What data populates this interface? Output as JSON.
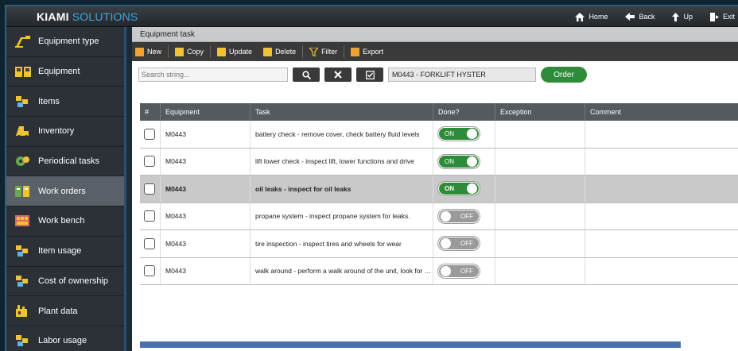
{
  "app": {
    "brand_main": "KIAMI",
    "brand_sub": "SOLUTIONS"
  },
  "topnav": [
    {
      "label": "Home",
      "icon": "home-icon"
    },
    {
      "label": "Back",
      "icon": "back-arrow-icon"
    },
    {
      "label": "Up",
      "icon": "up-arrow-icon"
    },
    {
      "label": "Exit",
      "icon": "exit-door-icon"
    }
  ],
  "sidebar": {
    "items": [
      {
        "label": "Equipment type",
        "icon": "equipment-type-icon"
      },
      {
        "label": "Equipment",
        "icon": "equipment-icon"
      },
      {
        "label": "Items",
        "icon": "items-icon"
      },
      {
        "label": "Inventory",
        "icon": "inventory-icon"
      },
      {
        "label": "Periodical tasks",
        "icon": "periodical-tasks-icon"
      },
      {
        "label": "Work orders",
        "icon": "work-orders-icon",
        "active": true
      },
      {
        "label": "Work bench",
        "icon": "work-bench-icon"
      },
      {
        "label": "Item usage",
        "icon": "item-usage-icon"
      },
      {
        "label": "Cost of ownership",
        "icon": "cost-of-ownership-icon"
      },
      {
        "label": "Plant data",
        "icon": "plant-data-icon"
      },
      {
        "label": "Labor usage",
        "icon": "labor-usage-icon"
      }
    ]
  },
  "main": {
    "title": "Equipment task",
    "toolbar": {
      "new": "New",
      "copy": "Copy",
      "update": "Update",
      "delete": "Delete",
      "filter": "Filter",
      "export": "Export"
    },
    "search": {
      "placeholder": "Search string...",
      "equipment_value": "M0443 - FORKLIFT HYSTER",
      "order_label": "Order"
    },
    "table": {
      "headers": [
        "#",
        "Equipment",
        "Task",
        "Done?",
        "Exception",
        "Comment"
      ],
      "rows": [
        {
          "equipment": "M0443",
          "task": "battery check - remove cover, check battery fluid levels",
          "done": "ON",
          "selected": false
        },
        {
          "equipment": "M0443",
          "task": "lift lower check - inspect lift, lower functions and drive",
          "done": "ON",
          "selected": false
        },
        {
          "equipment": "M0443",
          "task": "oil leaks - inspect for oil leaks",
          "done": "ON",
          "selected": true
        },
        {
          "equipment": "M0443",
          "task": "propane system - inspect propane system for leaks.",
          "done": "OFF",
          "selected": false
        },
        {
          "equipment": "M0443",
          "task": "tire inspection - inspect tires and wheels for wear",
          "done": "OFF",
          "selected": false
        },
        {
          "equipment": "M0443",
          "task": "walk around - perform a walk around of the unit, look for damage",
          "done": "OFF",
          "selected": false
        }
      ]
    }
  },
  "colors": {
    "accent": "#39a8e0",
    "on": "#2e8b3a",
    "off": "#9a9a9a",
    "sidebar": "#2b3137"
  }
}
